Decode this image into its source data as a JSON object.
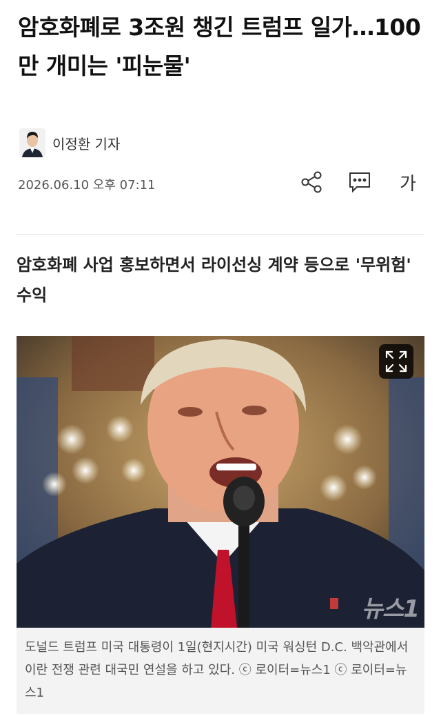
{
  "article": {
    "headline": "암호화폐로 3조원 챙긴 트럼프 일가…100만 개미는 '피눈물'",
    "reporter": "이정환 기자",
    "datetime": "2026.06.10 오후 07:11",
    "subheadline": "암호화폐 사업 홍보하면서 라이선싱 계약 등으로 '무위험' 수익",
    "photo_caption": "도널드 트럼프 미국 대통령이 1일(현지시간) 미국 워싱턴 D.C. 백악관에서 이란 전쟁 관련 대국민 연설을 하고 있다. ⓒ 로이터=뉴스1 ⓒ 로이터=뉴스1",
    "watermark": "뉴스1"
  },
  "toolbar": {
    "share_icon": "share-icon",
    "comment_icon": "comment-icon",
    "font_size_label": "가"
  },
  "photo": {
    "expand_icon": "expand-icon"
  }
}
